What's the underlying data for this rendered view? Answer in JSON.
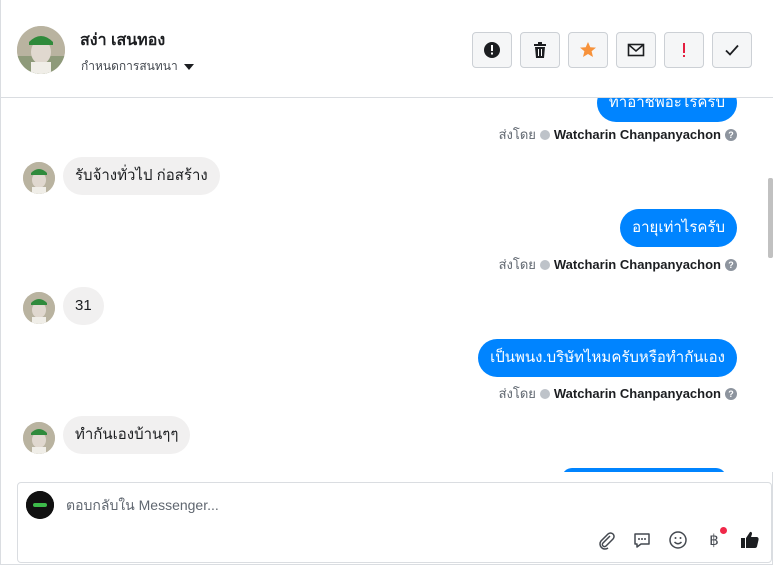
{
  "header": {
    "contact_name": "สง่า เสนทอง",
    "assign_label": "กำหนดการสนทนา",
    "toolbar": [
      {
        "icon": "alert-circle-icon",
        "title": "สแปม"
      },
      {
        "icon": "trash-icon",
        "title": "ลบ"
      },
      {
        "icon": "star-icon",
        "title": "ติดดาว"
      },
      {
        "icon": "envelope-icon",
        "title": "ยังไม่ได้อ่าน"
      },
      {
        "icon": "exclamation-icon",
        "title": "ติดตามผล"
      },
      {
        "icon": "check-icon",
        "title": "เสร็จสิ้น"
      }
    ]
  },
  "messages": [
    {
      "dir": "out",
      "text": "ทำอาชีพอะไรครับ"
    },
    {
      "dir": "meta",
      "prefix": "ส่งโดย",
      "sender": "Watcharin Chanpanyachon"
    },
    {
      "dir": "in",
      "text": "รับจ้างทั่วไป ก่อสร้าง"
    },
    {
      "dir": "out",
      "text": "อายุเท่าไรครับ"
    },
    {
      "dir": "meta",
      "prefix": "ส่งโดย",
      "sender": "Watcharin Chanpanyachon"
    },
    {
      "dir": "in",
      "text": "31"
    },
    {
      "dir": "out",
      "text": "เป็นพนง.บริษัทไหมครับหรือทำกันเอง"
    },
    {
      "dir": "meta",
      "prefix": "ส่งโดย",
      "sender": "Watcharin Chanpanyachon"
    },
    {
      "dir": "in",
      "text": "ทำกันเองบ้านๆๆ"
    }
  ],
  "composer": {
    "placeholder": "ตอบกลับใน Messenger..."
  },
  "colors": {
    "outgoing_bubble": "#0084ff",
    "incoming_bubble": "#f1f0f0",
    "star": "#f7923b",
    "exclamation": "#e41e3f",
    "notification_dot": "#f02849"
  }
}
